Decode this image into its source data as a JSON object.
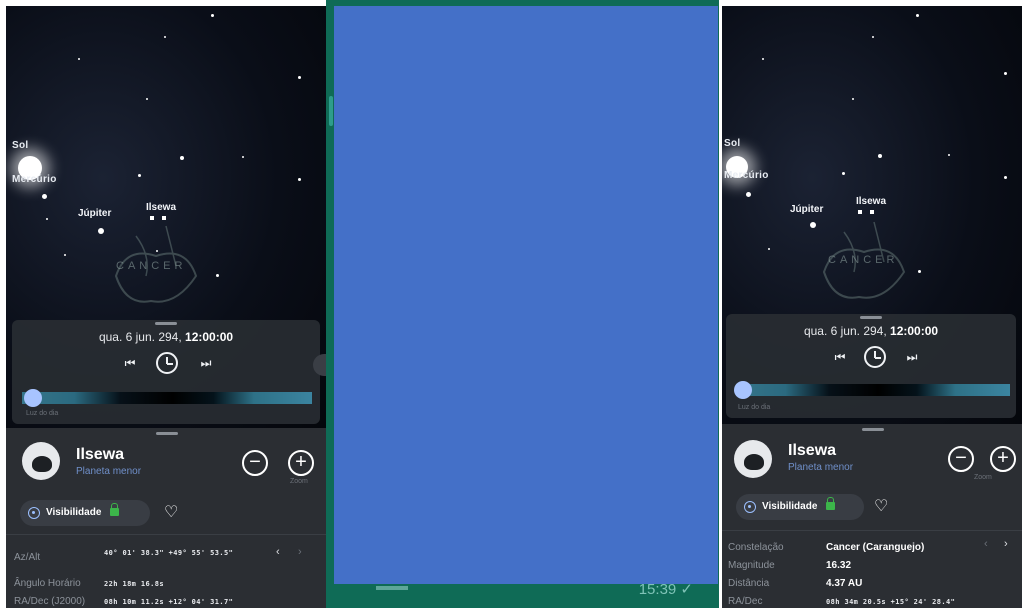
{
  "left": {
    "sky_labels": {
      "sun": "Sol",
      "mercury": "Mercúrio",
      "jupiter": "Júpiter",
      "ilsewa": "Ilsewa",
      "constellation": "CANCER"
    },
    "time_panel": {
      "date": "qua. 6 jun. 294,",
      "time": "12:00:00",
      "prev": "⏮",
      "next": "⏭",
      "daylight_label": "Luz do dia",
      "slider_fraction": 0.05
    },
    "object": {
      "name": "Ilsewa",
      "type": "Planeta menor",
      "zoom_label": "Zoom",
      "visibility_label": "Visibilidade"
    },
    "info": [
      {
        "label": "Az/Alt",
        "value": "40° 01' 38.3\"   +49° 55' 53.5\""
      },
      {
        "label": "Ângulo Horário",
        "value": "22h 18m 16.8s"
      },
      {
        "label": "RA/Dec (J2000)",
        "value": "08h 10m 11.2s   +12° 04' 31.7\""
      }
    ]
  },
  "center": {
    "status_time": "15:39 ✓"
  },
  "right": {
    "sky_labels": {
      "sun": "Sol",
      "mercury": "Mercúrio",
      "jupiter": "Júpiter",
      "ilsewa": "Ilsewa",
      "constellation": "CANCER"
    },
    "time_panel": {
      "date": "qua. 6 jun. 294,",
      "time": "12:00:00",
      "prev": "⏮",
      "next": "⏭",
      "daylight_label": "Luz do dia",
      "slider_fraction": 0.05
    },
    "object": {
      "name": "Ilsewa",
      "type": "Planeta menor",
      "zoom_label": "Zoom",
      "visibility_label": "Visibilidade"
    },
    "info": [
      {
        "label": "Constelação",
        "value": "Cancer (Caranguejo)"
      },
      {
        "label": "Magnitude",
        "value": "16.32"
      },
      {
        "label": "Distância",
        "value": "4.37 AU"
      },
      {
        "label": "RA/Dec",
        "value": "08h 34m 20.5s   +15° 24' 28.4\""
      }
    ]
  },
  "colors": {
    "panel": "#2b2e33",
    "accent": "#4470c8",
    "frame": "#0f6b56",
    "lock": "#3cb54a"
  }
}
